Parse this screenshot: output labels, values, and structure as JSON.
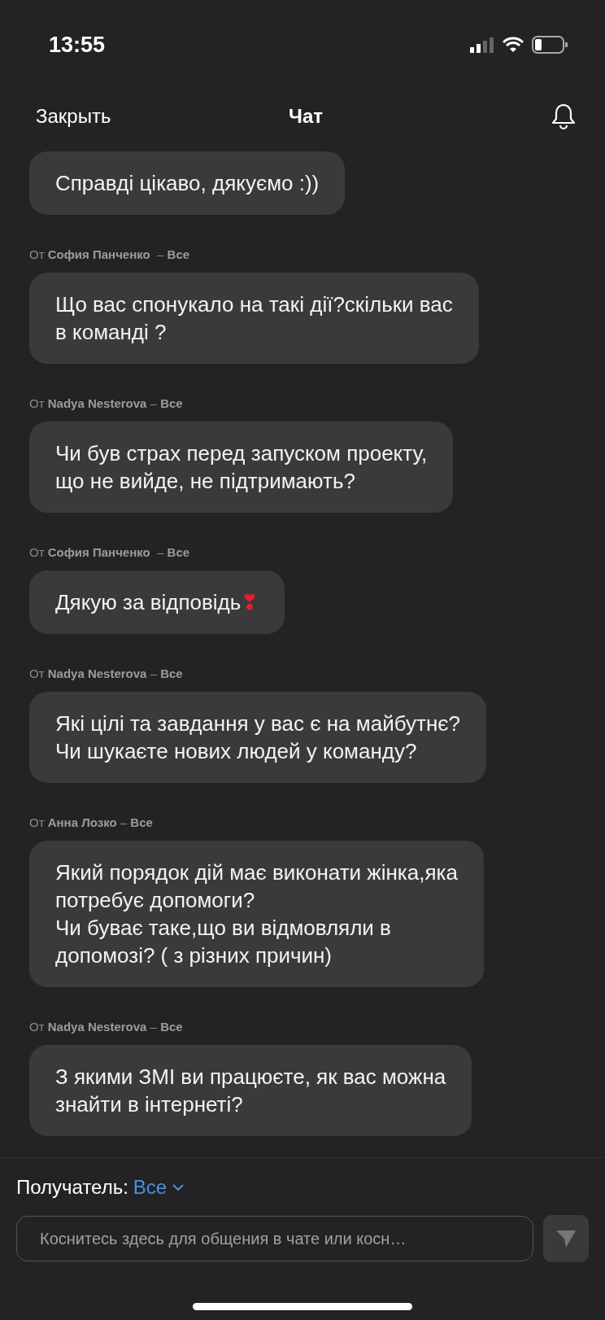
{
  "status_bar": {
    "time": "13:55"
  },
  "header": {
    "close": "Закрыть",
    "title": "Чат"
  },
  "messages": [
    {
      "text": "Справді цікаво, дякуємо :))"
    },
    {
      "sender": "От **София Панченко**  – **Все**",
      "text": "Що вас спонукало на такі дії?скільки вас\nв команді ?"
    },
    {
      "sender": "От **Nadya Nesterova** – **Все**",
      "text": "Чи був страх перед запуском проекту,\nщо не вийде, не підтримають?"
    },
    {
      "sender": "От **София Панченко**  – **Все**",
      "text": "Дякую за відповідь",
      "emoji": "❣"
    },
    {
      "sender": "От **Nadya Nesterova** – **Все**",
      "text": "Які цілі та завдання у вас є на майбутнє?\nЧи шукаєте нових людей у команду?"
    },
    {
      "sender": "От **Анна Лозко** – **Все**",
      "text": "Який порядок дій має виконати жінка,яка\nпотребує допомоги?\nЧи буває таке,що ви відмовляли в\nдопомозі? ( з різних причин)"
    },
    {
      "sender": "От **Nadya Nesterova** – **Все**",
      "text": "З якими ЗМІ ви працюєте, як вас можна\nзнайти в інтернеті?"
    }
  ],
  "composer": {
    "recipient_label": "Получатель:",
    "recipient": "Все",
    "placeholder": "Коснитесь здесь для общения в чате или косн…",
    "send_disabled": true
  }
}
